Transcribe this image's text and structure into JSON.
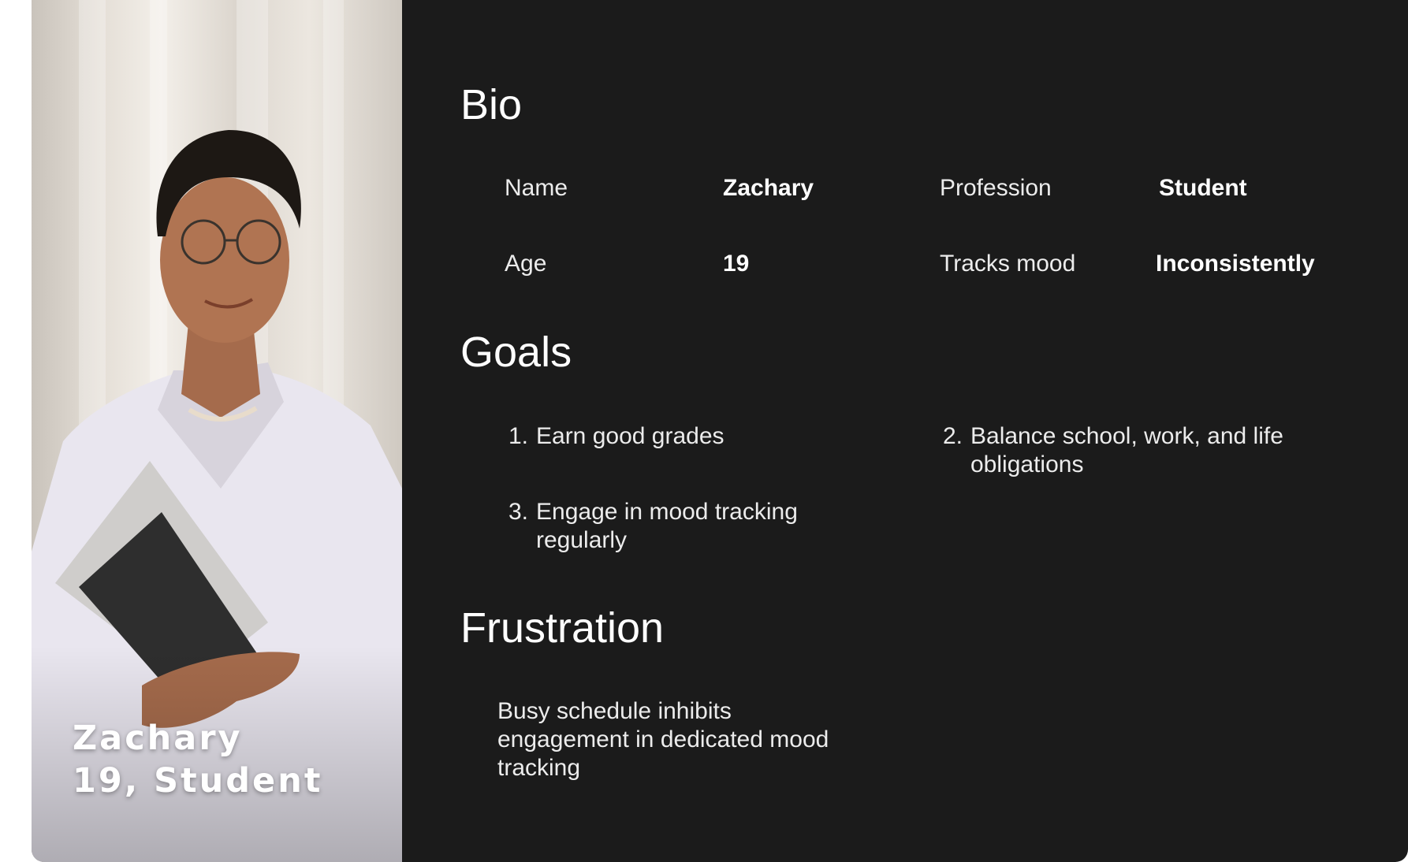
{
  "photo": {
    "overlay_name": "Zachary",
    "overlay_detail": "19, Student"
  },
  "bio": {
    "heading": "Bio",
    "name_label": "Name",
    "name_value": "Zachary",
    "profession_label": "Profession",
    "profession_value": "Student",
    "age_label": "Age",
    "age_value": "19",
    "tracks_label": "Tracks mood",
    "tracks_value": "Inconsistently"
  },
  "goals": {
    "heading": "Goals",
    "items": [
      {
        "num": "1.",
        "text": "Earn good grades"
      },
      {
        "num": "2.",
        "text": "Balance school, work, and life obligations"
      },
      {
        "num": "3.",
        "text": "Engage in mood tracking regularly"
      }
    ]
  },
  "frustration": {
    "heading": "Frustration",
    "text": "Busy schedule inhibits engagement in dedicated mood tracking"
  }
}
